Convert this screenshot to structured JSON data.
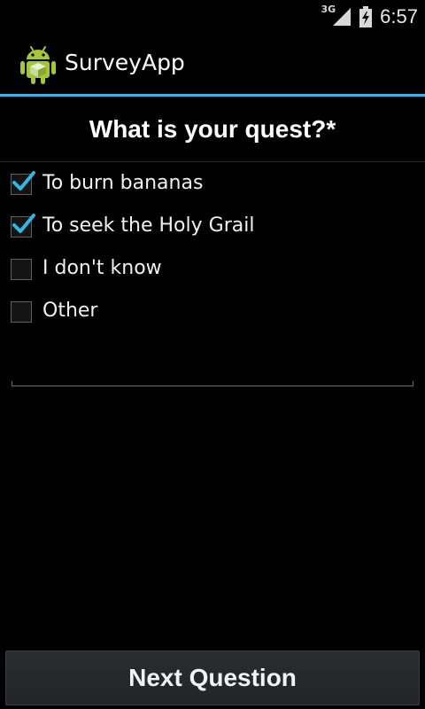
{
  "status_bar": {
    "network": "3G",
    "time": "6:57",
    "icons": [
      "signal-icon",
      "battery-icon"
    ]
  },
  "action_bar": {
    "title": "SurveyApp",
    "icon": "android-icon"
  },
  "question": {
    "text": "What is your quest?*"
  },
  "options": [
    {
      "label": "To burn bananas",
      "checked": true
    },
    {
      "label": "To seek the Holy Grail",
      "checked": true
    },
    {
      "label": "I don't know",
      "checked": false
    },
    {
      "label": "Other",
      "checked": false
    }
  ],
  "other_field": {
    "value": ""
  },
  "next_button": {
    "label": "Next Question"
  },
  "colors": {
    "accent": "#33b5e5",
    "android_green": "#a4c639",
    "background": "#000000"
  }
}
